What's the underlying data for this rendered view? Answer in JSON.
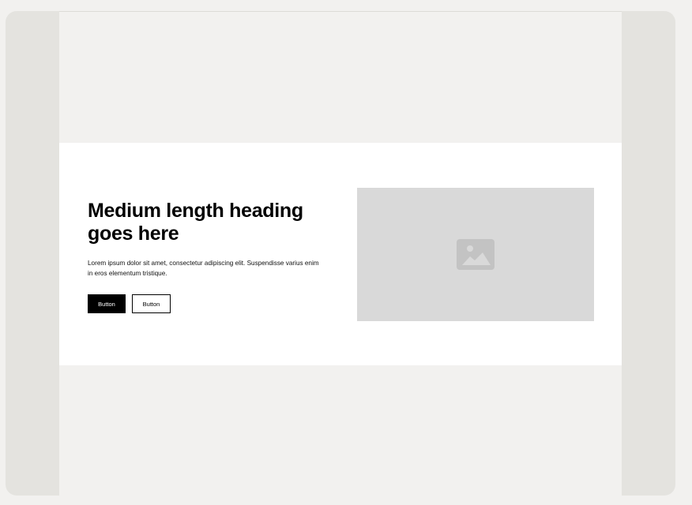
{
  "hero": {
    "heading": "Medium length heading goes here",
    "body": "Lorem ipsum dolor sit amet, consectetur adipiscing elit. Suspendisse varius enim in eros elementum tristique.",
    "primary_button_label": "Button",
    "secondary_button_label": "Button",
    "image_icon": "image-icon"
  },
  "colors": {
    "page_background": "#f2f1ef",
    "canvas_background": "#e4e3df",
    "hero_background": "#ffffff",
    "placeholder_background": "#d9d9d9",
    "primary_button": "#000000"
  }
}
